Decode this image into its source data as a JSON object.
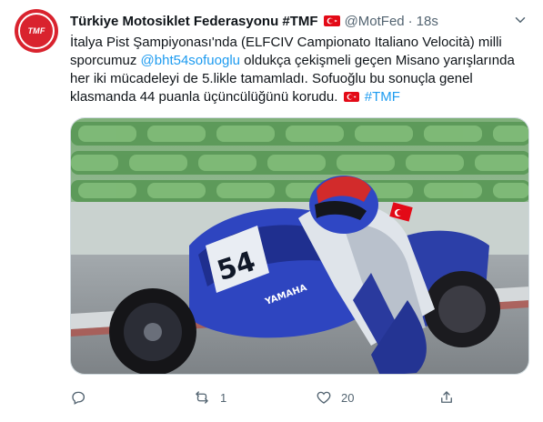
{
  "author": {
    "name": "Türkiye Motosiklet Federasyonu #TMF",
    "handle": "@MotFed",
    "time": "18s",
    "separator": "·",
    "avatar_text": "TMF"
  },
  "tweet": {
    "part1": "İtalya Pist Şampiyonası'nda (ELFCIV Campionato Italiano Velocità) milli sporcumuz ",
    "mention": "@bht54sofuoglu",
    "part2": " oldukça çekişmeli geçen Misano yarışlarında her iki mücadeleyi de 5.likle tamamladı. Sofuoğlu bu sonuçla genel klasmanda 44 puanla üçüncülüğünü korudu. ",
    "hashtag": "#TMF"
  },
  "media": {
    "bike_number": "54",
    "bike_brand": "YAMAHA"
  },
  "actions": {
    "reply_count": "",
    "retweet_count": "1",
    "like_count": "20",
    "share_count": ""
  },
  "colors": {
    "link": "#1d9bf0",
    "muted": "#536471",
    "flag_red": "#e30a17",
    "avatar_red": "#d9232e"
  }
}
